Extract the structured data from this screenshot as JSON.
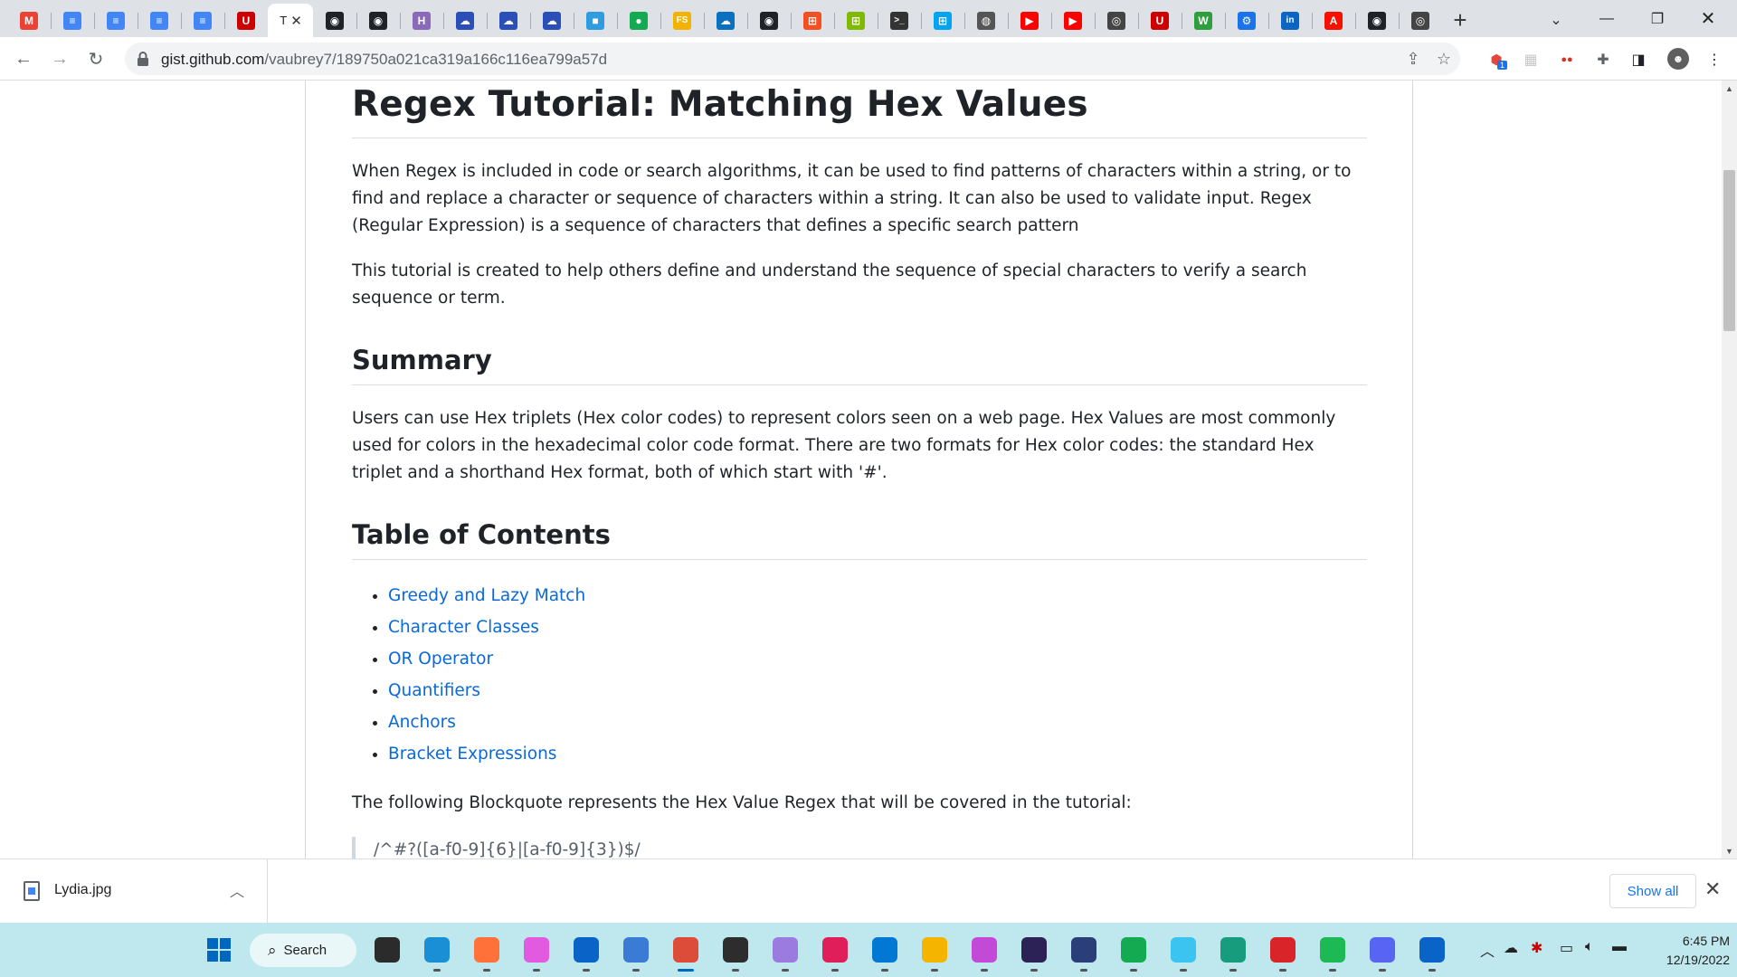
{
  "browser": {
    "tabs": [
      {
        "icon": "gmail-icon",
        "letter": "M",
        "color": "#ea4335"
      },
      {
        "icon": "google-docs-icon",
        "letter": "≡",
        "color": "#4285f4"
      },
      {
        "icon": "google-docs-icon",
        "letter": "≡",
        "color": "#4285f4"
      },
      {
        "icon": "google-docs-icon",
        "letter": "≡",
        "color": "#4285f4"
      },
      {
        "icon": "google-docs-icon",
        "letter": "≡",
        "color": "#4285f4"
      },
      {
        "icon": "utah-u-icon",
        "letter": "U",
        "color": "#cc0000"
      },
      {
        "icon": "github-icon",
        "letter": "",
        "color": "#1f2328",
        "active": true
      },
      {
        "icon": "github-icon",
        "letter": "◉",
        "color": "#1f2328"
      },
      {
        "icon": "github-icon",
        "letter": "◉",
        "color": "#1f2328"
      },
      {
        "icon": "heroku-icon",
        "letter": "H",
        "color": "#8a6ab8"
      },
      {
        "icon": "onedrive-icon",
        "letter": "☁",
        "color": "#2b4fb8"
      },
      {
        "icon": "onedrive-icon",
        "letter": "☁",
        "color": "#2b4fb8"
      },
      {
        "icon": "onedrive-icon",
        "letter": "☁",
        "color": "#2b4fb8"
      },
      {
        "icon": "azure-icon",
        "letter": "■",
        "color": "#2f9ce0"
      },
      {
        "icon": "mongodb-icon",
        "letter": "●",
        "color": "#13aa52"
      },
      {
        "icon": "fs-icon",
        "letter": "FS",
        "color": "#f2b300"
      },
      {
        "icon": "cloud-icon",
        "letter": "☁",
        "color": "#0a70c0"
      },
      {
        "icon": "github-icon",
        "letter": "◉",
        "color": "#1f2328"
      },
      {
        "icon": "microsoft-icon",
        "letter": "⊞",
        "color": "#f25022"
      },
      {
        "icon": "microsoft-icon",
        "letter": "⊞",
        "color": "#7fba00"
      },
      {
        "icon": "terminal-icon",
        "letter": ">_",
        "color": "#333333"
      },
      {
        "icon": "microsoft-icon",
        "letter": "⊞",
        "color": "#00a4ef"
      },
      {
        "icon": "globe-icon",
        "letter": "◍",
        "color": "#555555"
      },
      {
        "icon": "youtube-icon",
        "letter": "▶",
        "color": "#ff0000"
      },
      {
        "icon": "youtube-icon",
        "letter": "▶",
        "color": "#ff0000"
      },
      {
        "icon": "chrome-icon",
        "letter": "◎",
        "color": "#444444"
      },
      {
        "icon": "utah-u-icon",
        "letter": "U",
        "color": "#cc0000"
      },
      {
        "icon": "webex-icon",
        "letter": "W",
        "color": "#2e9e3e"
      },
      {
        "icon": "settings-icon",
        "letter": "⚙",
        "color": "#1a73e8"
      },
      {
        "icon": "linkedin-icon",
        "letter": "in",
        "color": "#0a66c2"
      },
      {
        "icon": "adobe-icon",
        "letter": "A",
        "color": "#fa0f00"
      },
      {
        "icon": "github-icon",
        "letter": "◉",
        "color": "#1f2328"
      },
      {
        "icon": "chrome-icon",
        "letter": "◎",
        "color": "#444444"
      }
    ],
    "active_tab_label": "T",
    "url_host": "gist.github.com",
    "url_path": "/vaubrey7/189750a021ca319a166c116ea799a57d"
  },
  "article": {
    "title": "Regex Tutorial: Matching Hex Values",
    "intro_p1": "When Regex is included in code or search algorithms, it can be used to find patterns of characters within a string, or to find and replace a character or sequence of characters within a string. It can also be used to validate input. Regex (Regular Expression) is a sequence of characters that defines a specific search pattern",
    "intro_p2": "This tutorial is created to help others define and understand the sequence of special characters to verify a search sequence or term.",
    "summary_heading": "Summary",
    "summary_p": "Users can use Hex triplets (Hex color codes) to represent colors seen on a web page. Hex Values are most commonly used for colors in the hexadecimal color code format. There are two formats for Hex color codes: the standard Hex triplet and a shorthand Hex format, both of which start with '#'.",
    "toc_heading": "Table of Contents",
    "toc": [
      "Greedy and Lazy Match",
      "Character Classes",
      "OR Operator",
      "Quantifiers",
      "Anchors",
      "Bracket Expressions"
    ],
    "blockquote_intro": "The following Blockquote represents the Hex Value Regex that will be covered in the tutorial:",
    "blockquote": "/^#?([a-f0-9]{6}|[a-f0-9]{3})$/"
  },
  "downloads": {
    "file_name": "Lydia.jpg",
    "show_all": "Show all"
  },
  "taskbar": {
    "search_label": "Search",
    "time": "6:45 PM",
    "date": "12/19/2022",
    "apps": [
      {
        "name": "task-view-icon",
        "color": "#2b2b2b"
      },
      {
        "name": "edge-icon",
        "color": "#1a8fd6"
      },
      {
        "name": "firefox-icon",
        "color": "#ff7139"
      },
      {
        "name": "itunes-icon",
        "color": "#e25ae0"
      },
      {
        "name": "outlook-icon",
        "color": "#0a64c8"
      },
      {
        "name": "notepad-icon",
        "color": "#3a7bd5"
      },
      {
        "name": "chrome-icon",
        "color": "#dd4b39",
        "running": true
      },
      {
        "name": "terminal-icon",
        "color": "#2d2d2d"
      },
      {
        "name": "gitkraken-icon",
        "color": "#9b7be0"
      },
      {
        "name": "slack-icon",
        "color": "#e01e5a"
      },
      {
        "name": "vscode-icon",
        "color": "#0078d4"
      },
      {
        "name": "file-explorer-icon",
        "color": "#f4b400"
      },
      {
        "name": "snipping-tool-icon",
        "color": "#c24ad6"
      },
      {
        "name": "eclipse-icon",
        "color": "#2c2255"
      },
      {
        "name": "network-icon",
        "color": "#2a3f7a"
      },
      {
        "name": "mongodb-compass-icon",
        "color": "#13aa52"
      },
      {
        "name": "paint-icon",
        "color": "#3bc4f0"
      },
      {
        "name": "gitkraken-alt-icon",
        "color": "#179c7d"
      },
      {
        "name": "heroku-cli-icon",
        "color": "#d9252a"
      },
      {
        "name": "spotify-icon",
        "color": "#1db954"
      },
      {
        "name": "discord-icon",
        "color": "#5865f2"
      },
      {
        "name": "mail-icon",
        "color": "#0a64c8"
      }
    ]
  }
}
